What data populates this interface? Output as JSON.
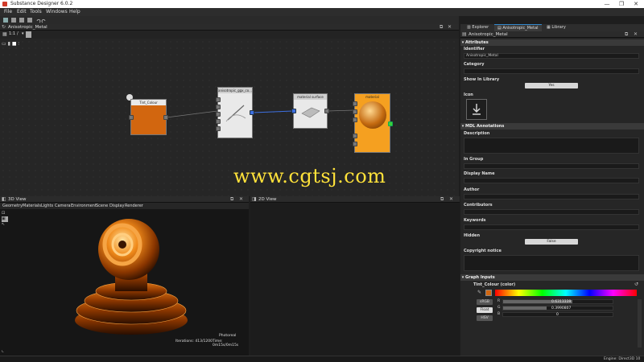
{
  "window": {
    "title": "Substance Designer 6.0.2",
    "controls": [
      "—",
      "❐",
      "✕"
    ]
  },
  "menu": [
    "File",
    "Edit",
    "Tools",
    "Windows",
    "Help"
  ],
  "graph_panel": {
    "title": "Anisotropic_Metal",
    "zoom": "1:1",
    "separator": "/"
  },
  "nodes": {
    "tint": {
      "title": "Tint_Colour",
      "color": "#d2660f"
    },
    "aniso": {
      "title": "anisotropic_ggx_co..."
    },
    "surface": {
      "title": "material surface"
    },
    "output": {
      "title": "material"
    }
  },
  "view3d": {
    "title": "3D View",
    "menu": [
      "Geometry",
      "Materials",
      "Lights",
      "Camera",
      "Environment",
      "Scene",
      "Display",
      "Renderer"
    ],
    "mode": "Photoreal",
    "iterations": "Iterations: 413/1200",
    "time": "Time: 0m15s/0m15s"
  },
  "view2d": {
    "title": "2D View"
  },
  "right_panel": {
    "tabs": [
      "Explorer",
      "Anisotropic_Metal",
      "Library"
    ],
    "header": "Anisotropic_Metal",
    "attributes_title": "Attributes",
    "identifier_label": "Identifier",
    "identifier_value": "Anisotropic_Metal",
    "category_label": "Category",
    "show_in_library_label": "Show In Library",
    "show_in_library_value": "Yes",
    "icon_label": "Icon",
    "mdl_title": "MDL Annotations",
    "description_label": "Description",
    "in_group_label": "In Group",
    "display_name_label": "Display Name",
    "author_label": "Author",
    "contributors_label": "Contributors",
    "keywords_label": "Keywords",
    "hidden_label": "Hidden",
    "hidden_value": "False",
    "copyright_label": "Copyright notice",
    "graph_inputs_title": "Graph Inputs",
    "input_name": "Tint_Colour (color)",
    "modes": [
      "sRGB",
      "Float",
      "HSV"
    ],
    "channels": [
      {
        "label": "R",
        "value": "0.6313339"
      },
      {
        "label": "G",
        "value": "0.3990807"
      },
      {
        "label": "B",
        "value": "0"
      }
    ],
    "swatch_color": "#d2660f"
  },
  "status": {
    "engine": "Engine: Direct3D 10"
  },
  "watermark": "www.cgtsj.com"
}
